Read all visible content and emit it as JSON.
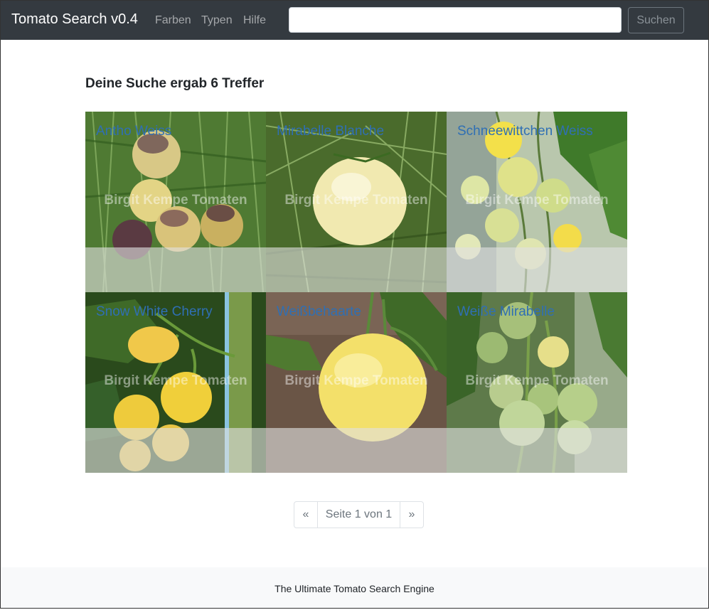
{
  "navbar": {
    "brand": "Tomato Search v0.4",
    "links": [
      "Farben",
      "Typen",
      "Hilfe"
    ],
    "search_value": "",
    "search_button": "Suchen"
  },
  "results": {
    "heading": "Deine Suche ergab 6 Treffer",
    "watermark": "Birgit Kempe Tomaten",
    "items": [
      {
        "name": "Antho Weiss"
      },
      {
        "name": "Mirabelle Blanche"
      },
      {
        "name": "Schneewittchen Weiss"
      },
      {
        "name": "Snow White Cherry"
      },
      {
        "name": "Weißbehaarte"
      },
      {
        "name": "Weiße Mirabelle"
      }
    ]
  },
  "pagination": {
    "prev": "«",
    "info": "Seite 1 von 1",
    "next": "»"
  },
  "footer": {
    "text": "The Ultimate Tomato Search Engine"
  },
  "colors": {
    "navbar_bg": "#343a40",
    "link": "#2f6fb4",
    "footer_bg": "#f8f9fa"
  }
}
